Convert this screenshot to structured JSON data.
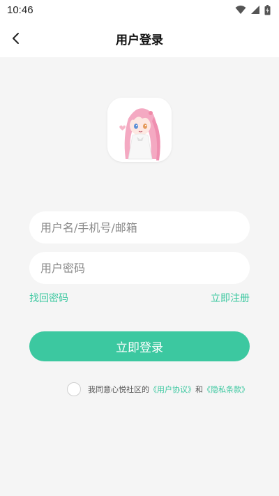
{
  "status": {
    "time": "10:46"
  },
  "nav": {
    "title": "用户登录"
  },
  "form": {
    "username_placeholder": "用户名/手机号/邮箱",
    "password_placeholder": "用户密码",
    "forgot_label": "找回密码",
    "register_label": "立即注册",
    "login_label": "立即登录"
  },
  "agreement": {
    "prefix": "我同意心悦社区的",
    "terms_link": "《用户协议》",
    "joiner": "和",
    "privacy_link": "《隐私条款》"
  },
  "colors": {
    "accent": "#3cc8a0",
    "background": "#f5f5f5"
  },
  "icons": {
    "back": "chevron-left-icon",
    "wifi": "wifi-icon",
    "signal": "signal-icon",
    "battery": "battery-icon"
  }
}
